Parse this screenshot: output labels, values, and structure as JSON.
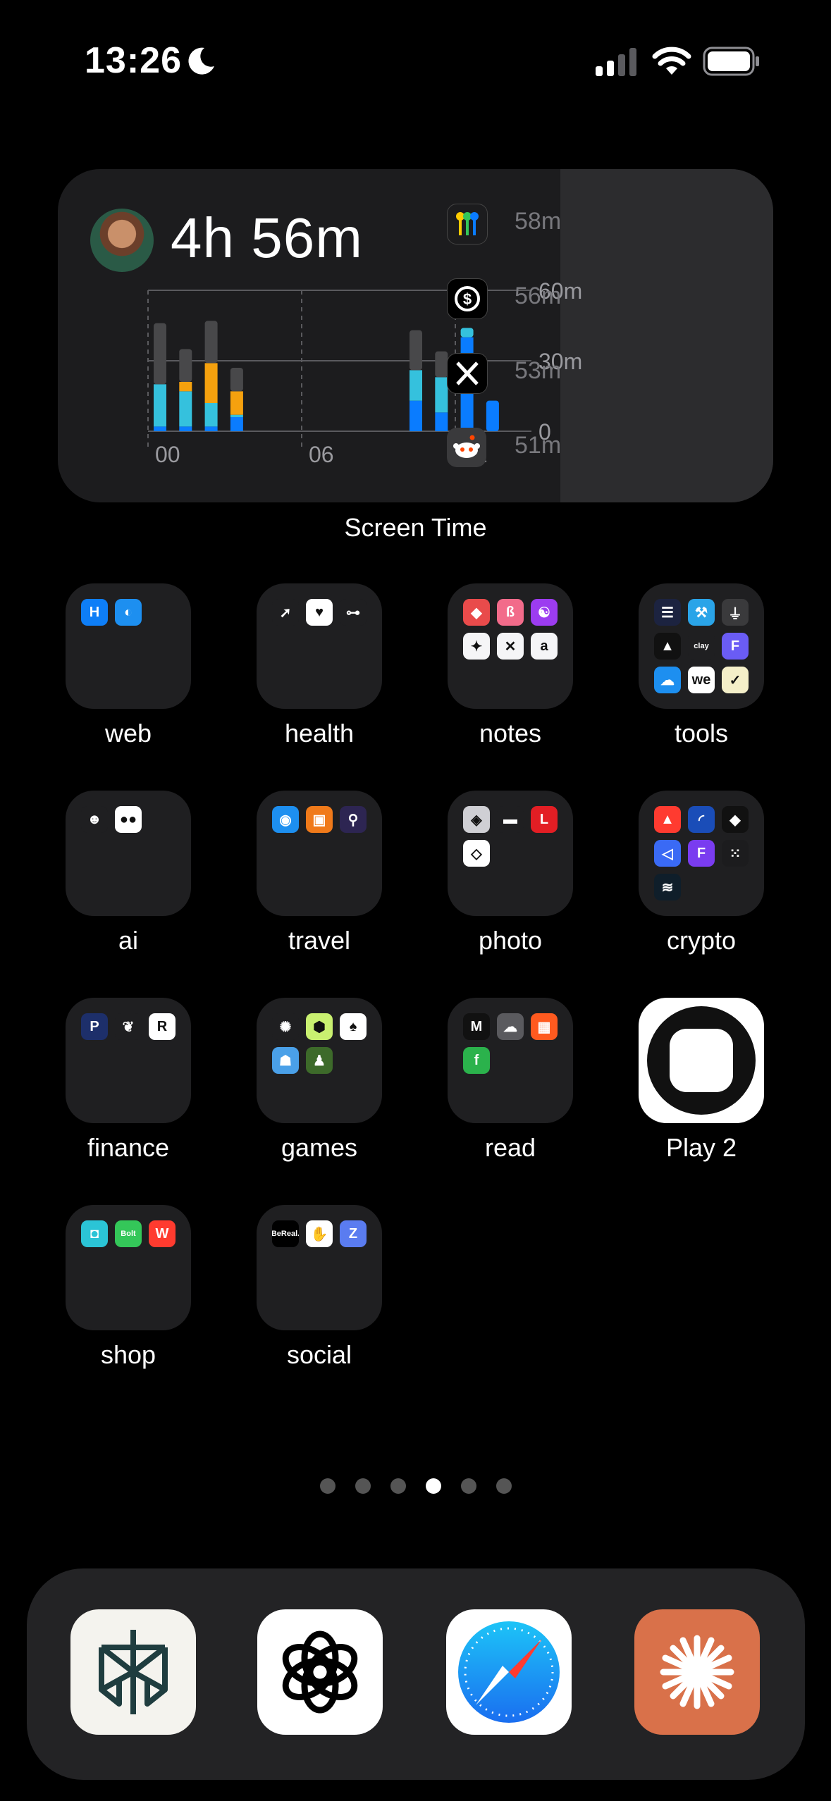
{
  "status_bar": {
    "time": "13:26",
    "focus_icon": "moon-icon"
  },
  "colors": {
    "accent_blue": "#0a7cff",
    "cyan": "#35c1dd",
    "orange": "#f5a10e",
    "gray_bar": "#48484a"
  },
  "screen_time_widget": {
    "total": "4h 56m",
    "label": "Screen Time",
    "top_apps": [
      {
        "name": "Passwords",
        "icon": "keys-icon",
        "time": "58m"
      },
      {
        "name": "Cash",
        "icon": "dollar-circle-icon",
        "time": "56m"
      },
      {
        "name": "X",
        "icon": "x-logo-icon",
        "time": "53m"
      },
      {
        "name": "Reddit",
        "icon": "reddit-icon",
        "time": "51m"
      }
    ]
  },
  "chart_data": {
    "type": "bar",
    "stacked": true,
    "x_tick_labels": [
      "00",
      "06",
      "12"
    ],
    "y_tick_labels": [
      "60m",
      "30m",
      "0"
    ],
    "ylim": [
      0,
      60
    ],
    "grid": true,
    "bars": [
      {
        "hour": 0,
        "segments": [
          {
            "color": "#0a7cff",
            "minutes": 2
          },
          {
            "color": "#35c1dd",
            "minutes": 18
          },
          {
            "color": "#48484a",
            "minutes": 26
          }
        ]
      },
      {
        "hour": 1,
        "segments": [
          {
            "color": "#0a7cff",
            "minutes": 2
          },
          {
            "color": "#35c1dd",
            "minutes": 15
          },
          {
            "color": "#f5a10e",
            "minutes": 4
          },
          {
            "color": "#48484a",
            "minutes": 14
          }
        ]
      },
      {
        "hour": 2,
        "segments": [
          {
            "color": "#0a7cff",
            "minutes": 2
          },
          {
            "color": "#35c1dd",
            "minutes": 10
          },
          {
            "color": "#f5a10e",
            "minutes": 17
          },
          {
            "color": "#48484a",
            "minutes": 18
          }
        ]
      },
      {
        "hour": 3,
        "segments": [
          {
            "color": "#0a7cff",
            "minutes": 6
          },
          {
            "color": "#35c1dd",
            "minutes": 1
          },
          {
            "color": "#f5a10e",
            "minutes": 10
          },
          {
            "color": "#48484a",
            "minutes": 10
          }
        ]
      },
      {
        "hour": 10,
        "segments": [
          {
            "color": "#0a7cff",
            "minutes": 13
          },
          {
            "color": "#35c1dd",
            "minutes": 13
          },
          {
            "color": "#48484a",
            "minutes": 17
          }
        ]
      },
      {
        "hour": 11,
        "segments": [
          {
            "color": "#0a7cff",
            "minutes": 8
          },
          {
            "color": "#35c1dd",
            "minutes": 15
          },
          {
            "color": "#48484a",
            "minutes": 11
          }
        ]
      },
      {
        "hour": 12,
        "segments": [
          {
            "color": "#0a7cff",
            "minutes": 40
          },
          {
            "color": "#35c1dd",
            "minutes": 4
          }
        ]
      },
      {
        "hour": 13,
        "segments": [
          {
            "color": "#0a7cff",
            "minutes": 13
          }
        ]
      }
    ]
  },
  "home_grid": [
    {
      "label": "web",
      "type": "folder",
      "icons": [
        {
          "icon": "hotel-h-icon",
          "bg": "#0e7ef7",
          "glyph": "H"
        },
        {
          "icon": "toggle-app-icon",
          "bg": "#1d8ff0",
          "glyph": "◐"
        }
      ]
    },
    {
      "label": "health",
      "type": "folder",
      "icons": [
        {
          "icon": "arrow-app-icon",
          "bg": "#1f1f21",
          "glyph": "➚"
        },
        {
          "icon": "heart-icon",
          "bg": "#ffffff",
          "glyph": "♥"
        },
        {
          "icon": "dumbbell-icon",
          "bg": "#1f1f21",
          "glyph": "⊶"
        }
      ]
    },
    {
      "label": "notes",
      "type": "folder",
      "icons": [
        {
          "icon": "bear-notes-icon",
          "bg": "#e94b4b",
          "glyph": "◆"
        },
        {
          "icon": "pink-app-icon",
          "bg": "#f26b8a",
          "glyph": "ß"
        },
        {
          "icon": "brain-icon",
          "bg": "#9c3cf0",
          "glyph": "☯"
        },
        {
          "icon": "craft-icon",
          "bg": "#f5f5f7",
          "glyph": "✦"
        },
        {
          "icon": "butterfly-icon",
          "bg": "#f5f5f7",
          "glyph": "✕"
        },
        {
          "icon": "draft-icon",
          "bg": "#f5f5f7",
          "glyph": "a"
        }
      ]
    },
    {
      "label": "tools",
      "type": "folder",
      "icons": [
        {
          "icon": "list-app-icon",
          "bg": "#1c2340",
          "glyph": "☰"
        },
        {
          "icon": "tool-app-icon",
          "bg": "#2aa4e8",
          "glyph": "⚒"
        },
        {
          "icon": "funnel-icon",
          "bg": "#3a3a3c",
          "glyph": "⏚"
        },
        {
          "icon": "triangle-app-icon",
          "bg": "#111111",
          "glyph": "▲"
        },
        {
          "icon": "clay-icon",
          "bg": "#1f1f21",
          "glyph": "clay"
        },
        {
          "icon": "purple-f-icon",
          "bg": "#6a5cf5",
          "glyph": "F"
        },
        {
          "icon": "cloud-app-icon",
          "bg": "#1d8ff0",
          "glyph": "☁"
        },
        {
          "icon": "we-app-icon",
          "bg": "#ffffff",
          "glyph": "we"
        },
        {
          "icon": "yellow-check-icon",
          "bg": "#f4efc9",
          "glyph": "✓"
        }
      ]
    },
    {
      "label": "ai",
      "type": "folder",
      "icons": [
        {
          "icon": "robot-icon",
          "bg": "#1f1f21",
          "glyph": "☻"
        },
        {
          "icon": "chat-bubbles-icon",
          "bg": "#ffffff",
          "glyph": "●●"
        }
      ]
    },
    {
      "label": "travel",
      "type": "folder",
      "icons": [
        {
          "icon": "camera-app-icon",
          "bg": "#1d8ff0",
          "glyph": "◉"
        },
        {
          "icon": "luggage-icon",
          "bg": "#f07a1a",
          "glyph": "▣"
        },
        {
          "icon": "map-pin-icon",
          "bg": "#2d2552",
          "glyph": "⚲"
        }
      ]
    },
    {
      "label": "photo",
      "type": "folder",
      "icons": [
        {
          "icon": "aperture-icon",
          "bg": "#cfcfd4",
          "glyph": "◈"
        },
        {
          "icon": "pill-app-icon",
          "bg": "#1f1f21",
          "glyph": "▬"
        },
        {
          "icon": "leica-icon",
          "bg": "#e31e24",
          "glyph": "L"
        },
        {
          "icon": "diamond-app-icon",
          "bg": "#ffffff",
          "glyph": "◇"
        }
      ]
    },
    {
      "label": "crypto",
      "type": "folder",
      "icons": [
        {
          "icon": "lock-app-icon",
          "bg": "#ff3b30",
          "glyph": "▲"
        },
        {
          "icon": "rainbow-icon",
          "bg": "#1a4db8",
          "glyph": "◜"
        },
        {
          "icon": "drop-icon",
          "bg": "#111111",
          "glyph": "◆"
        },
        {
          "icon": "bolt-app-icon",
          "bg": "#3a6af5",
          "glyph": "◁"
        },
        {
          "icon": "f-blocks-icon",
          "bg": "#7a3cf0",
          "glyph": "F"
        },
        {
          "icon": "dots-grid-icon",
          "bg": "#1c1c1e",
          "glyph": "⁙"
        },
        {
          "icon": "swirl-icon",
          "bg": "#0f1e2a",
          "glyph": "≋"
        }
      ]
    },
    {
      "label": "finance",
      "type": "folder",
      "icons": [
        {
          "icon": "paypal-icon",
          "bg": "#1d2f6a",
          "glyph": "P"
        },
        {
          "icon": "squirrel-icon",
          "bg": "#1f1f21",
          "glyph": "❦"
        },
        {
          "icon": "revolut-icon",
          "bg": "#ffffff",
          "glyph": "R"
        }
      ]
    },
    {
      "label": "games",
      "type": "folder",
      "icons": [
        {
          "icon": "spinner-icon",
          "bg": "#1f1f21",
          "glyph": "✺"
        },
        {
          "icon": "hex-app-icon",
          "bg": "#c9f070",
          "glyph": "⬢"
        },
        {
          "icon": "cards-icon",
          "bg": "#ffffff",
          "glyph": "♠"
        },
        {
          "icon": "pixel-game-icon",
          "bg": "#4aa0e8",
          "glyph": "☗"
        },
        {
          "icon": "chess-icon",
          "bg": "#3d6a2a",
          "glyph": "♟"
        }
      ]
    },
    {
      "label": "read",
      "type": "folder",
      "icons": [
        {
          "icon": "medium-icon",
          "bg": "#111111",
          "glyph": "M"
        },
        {
          "icon": "cloud-star-icon",
          "bg": "#5a5a5e",
          "glyph": "☁"
        },
        {
          "icon": "bookmark-icon",
          "bg": "#ff5a1f",
          "glyph": "▦"
        },
        {
          "icon": "feedly-icon",
          "bg": "#2bb24c",
          "glyph": "f"
        }
      ]
    },
    {
      "label": "Play 2",
      "type": "app",
      "icon": "play2-app-icon"
    },
    {
      "label": "shop",
      "type": "folder",
      "icons": [
        {
          "icon": "bag-icon",
          "bg": "#2bc4d6",
          "glyph": "◘"
        },
        {
          "icon": "bolt-food-icon",
          "bg": "#34c759",
          "glyph": "Bolt"
        },
        {
          "icon": "wolt-icon",
          "bg": "#ff3b2f",
          "glyph": "W"
        }
      ]
    },
    {
      "label": "social",
      "type": "folder",
      "icons": [
        {
          "icon": "bereal-icon",
          "bg": "#000000",
          "glyph": "BeReal."
        },
        {
          "icon": "wave-hand-icon",
          "bg": "#ffffff",
          "glyph": "✋"
        },
        {
          "icon": "z-app-icon",
          "bg": "#5a7cf0",
          "glyph": "Z"
        }
      ]
    }
  ],
  "page_indicator": {
    "count": 6,
    "active_index": 3
  },
  "dock": [
    {
      "name": "Perplexity",
      "icon": "perplexity-icon"
    },
    {
      "name": "ChatGPT",
      "icon": "chatgpt-icon"
    },
    {
      "name": "Safari",
      "icon": "safari-compass-icon"
    },
    {
      "name": "Claude",
      "icon": "claude-sparkle-icon"
    }
  ]
}
